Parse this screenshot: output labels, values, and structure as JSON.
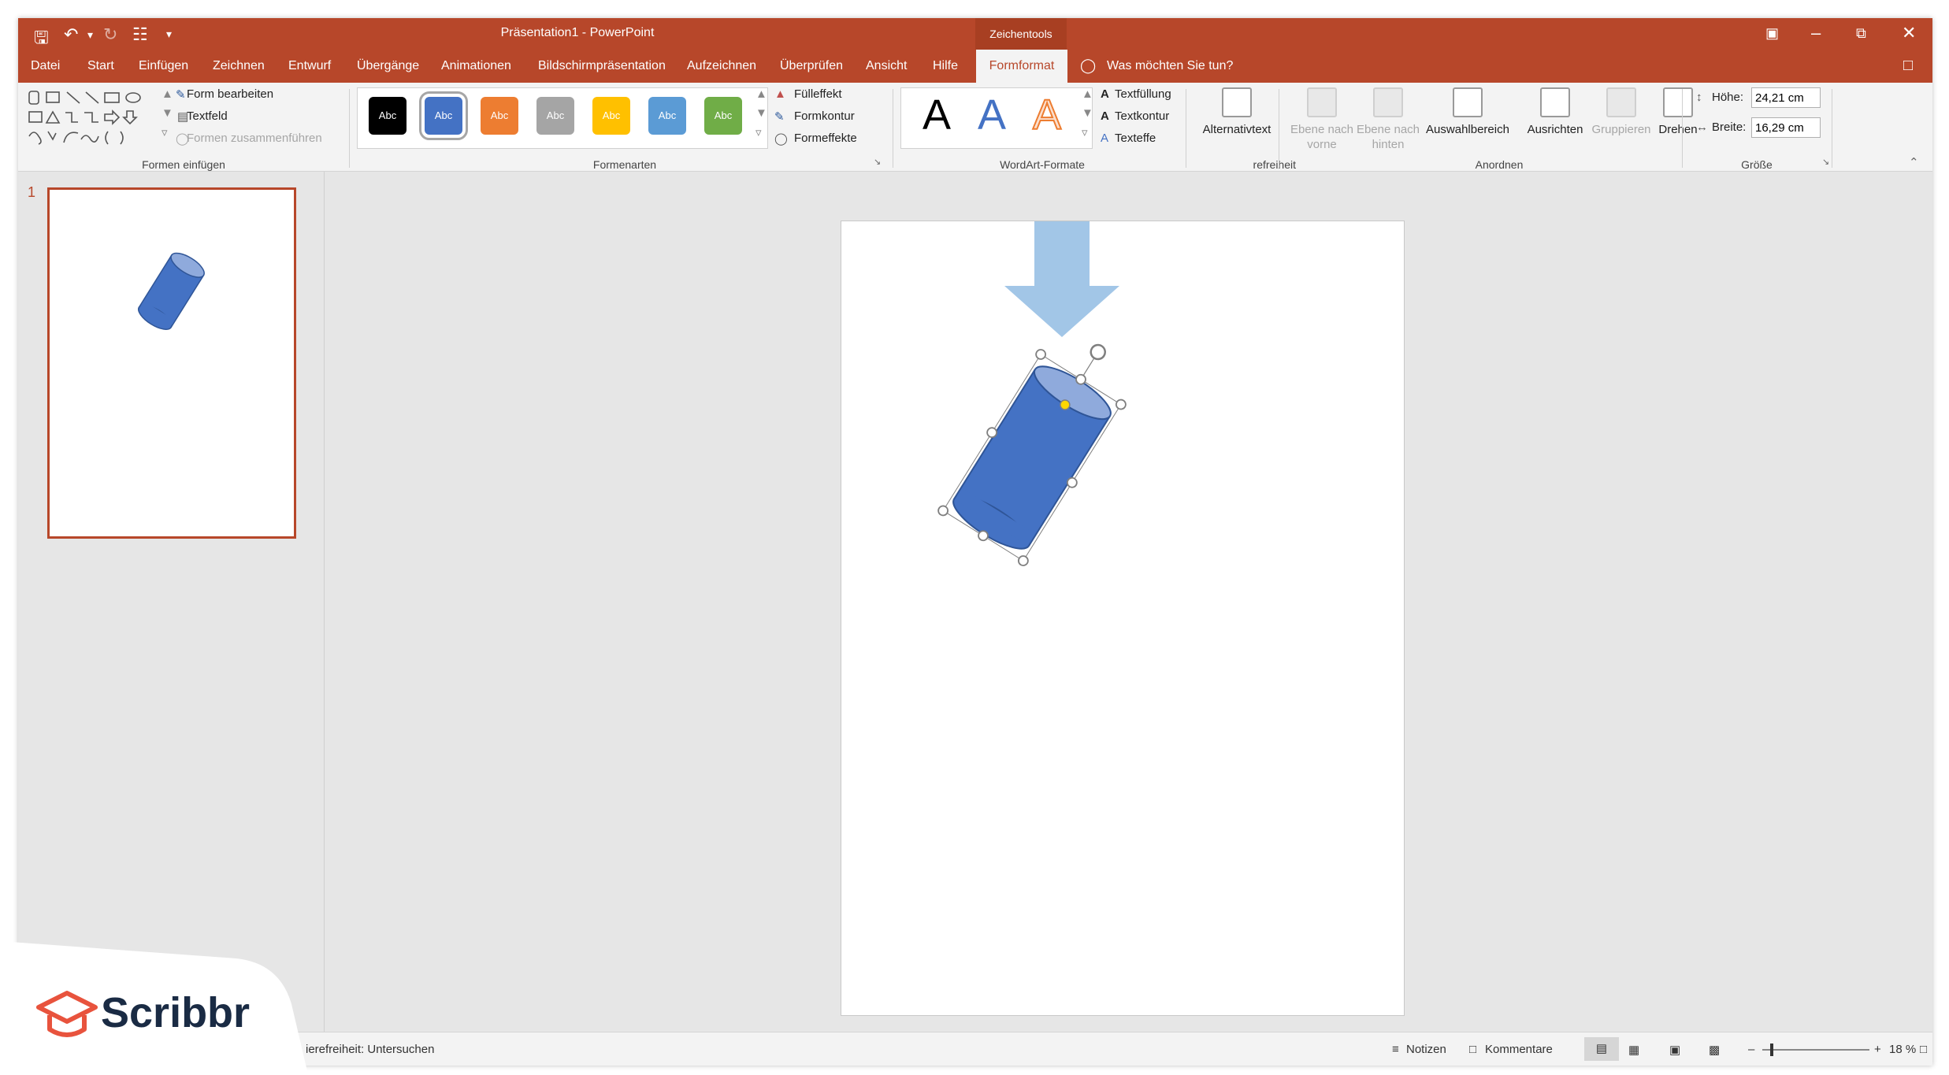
{
  "titlebar": {
    "title": "Präsentation1 - PowerPoint",
    "context_tab_group": "Zeichentools",
    "quick_access": [
      "save-icon",
      "undo-icon",
      "redo-icon",
      "presentation-icon",
      "customize-icon"
    ]
  },
  "tabs": [
    "Datei",
    "Start",
    "Einfügen",
    "Zeichnen",
    "Entwurf",
    "Übergänge",
    "Animationen",
    "Bildschirmpräsentation",
    "Aufzeichnen",
    "Überprüfen",
    "Ansicht",
    "Hilfe"
  ],
  "active_tab": "Formformat",
  "tell_me": "Was möchten Sie tun?",
  "ribbon": {
    "formen_einfuegen": {
      "label": "Formen einfügen",
      "form_bearbeiten": "Form bearbeiten",
      "textfeld": "Textfeld",
      "formen_zusammenfuehren": "Formen zusammenführen"
    },
    "formenarten": {
      "label": "Formenarten",
      "swatch_text": "Abc",
      "swatch_colors": [
        "#000000",
        "#4472c4",
        "#ed7d31",
        "#a5a5a5",
        "#ffc000",
        "#5b9bd5",
        "#70ad47"
      ],
      "fuelleffekt": "Fülleffekt",
      "formkontur": "Formkontur",
      "formeffekte": "Formeffekte"
    },
    "wordart": {
      "label": "WordArt-Formate",
      "letter": "A",
      "textfuellung": "Textfüllung",
      "textkontur": "Textkontur",
      "texteffekte": "Texteffe"
    },
    "barrierefreiheit": {
      "alternativtext": "Alternativtext",
      "label": "refreiheit"
    },
    "anordnen": {
      "label": "Anordnen",
      "ebene_vorne_1": "Ebene nach",
      "ebene_vorne_2": "vorne",
      "ebene_hinten_1": "Ebene nach",
      "ebene_hinten_2": "hinten",
      "auswahlbereich": "Auswahlbereich",
      "ausrichten": "Ausrichten",
      "gruppieren": "Gruppieren",
      "drehen": "Drehen"
    },
    "groesse": {
      "label": "Größe",
      "hoehe_label": "Höhe:",
      "hoehe_value": "24,21 cm",
      "breite_label": "Breite:",
      "breite_value": "16,29 cm"
    }
  },
  "thumbnail": {
    "number": "1"
  },
  "status": {
    "accessibility": "ierefreiheit: Untersuchen",
    "notizen": "Notizen",
    "kommentare": "Kommentare",
    "zoom": "18 %",
    "zoom_minus": "–",
    "zoom_plus": "+"
  },
  "brand": {
    "name": "Scribbr"
  },
  "colors": {
    "accent": "#b7472a",
    "shape": "#4472c4",
    "arrow": "#9dc3e6"
  }
}
